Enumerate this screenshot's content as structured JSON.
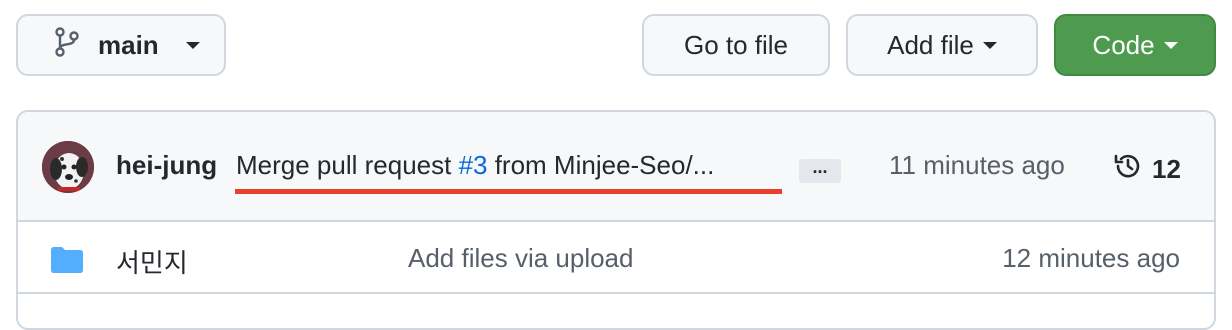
{
  "toolbar": {
    "branch_label": "main",
    "goto_file_label": "Go to file",
    "add_file_label": "Add file",
    "code_label": "Code"
  },
  "commit": {
    "author": "hei-jung",
    "message_prefix": "Merge pull request ",
    "pr_number": "#3",
    "message_suffix": " from Minjee-Seo/...",
    "ellipsis": "...",
    "time": "11 minutes ago",
    "history_count": "12"
  },
  "files": [
    {
      "icon": "folder-icon",
      "name": "서민지",
      "message": "Add files via upload",
      "time": "12 minutes ago"
    }
  ],
  "colors": {
    "code_button": "#4e9a4f",
    "link": "#0969da",
    "annotation_underline": "#e8402a",
    "folder": "#54aeff"
  }
}
